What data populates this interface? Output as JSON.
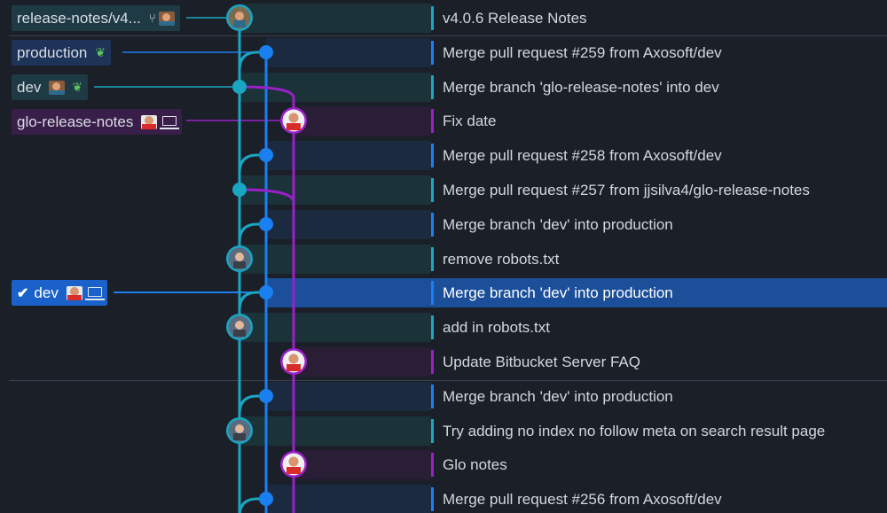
{
  "commits": [
    {
      "message": "v4.0.6 Release Notes",
      "lane": "teal"
    },
    {
      "message": "Merge pull request #259 from Axosoft/dev",
      "lane": "blue"
    },
    {
      "message": "Merge branch 'glo-release-notes' into dev",
      "lane": "teal"
    },
    {
      "message": "Fix date",
      "lane": "purple"
    },
    {
      "message": "Merge pull request #258 from Axosoft/dev",
      "lane": "blue"
    },
    {
      "message": "Merge pull request #257 from jjsilva4/glo-release-notes",
      "lane": "teal"
    },
    {
      "message": "Merge branch 'dev' into production",
      "lane": "blue"
    },
    {
      "message": "remove robots.txt",
      "lane": "teal"
    },
    {
      "message": "Merge branch 'dev' into production",
      "lane": "blue",
      "selected": true
    },
    {
      "message": "add in robots.txt",
      "lane": "teal"
    },
    {
      "message": "Update Bitbucket Server FAQ",
      "lane": "purple"
    },
    {
      "message": "Merge branch 'dev' into production",
      "lane": "blue"
    },
    {
      "message": "Try adding no index no follow meta on search result page",
      "lane": "teal"
    },
    {
      "message": "Glo notes",
      "lane": "purple"
    },
    {
      "message": "Merge pull request #256 from Axosoft/dev",
      "lane": "blue"
    }
  ],
  "refs": {
    "release_notes": "release-notes/v4...",
    "production": "production",
    "dev": "dev",
    "glo_release_notes": "glo-release-notes",
    "dev_checked_out": "dev"
  },
  "colors": {
    "teal": "#1aa5c2",
    "blue": "#1a7ff0",
    "purple": "#9a20c8",
    "selected": "#1c4f9a"
  },
  "icons": {
    "leaf": "leaf-icon",
    "laptop": "laptop-icon",
    "check": "check-icon",
    "branch": "branch-icon"
  }
}
